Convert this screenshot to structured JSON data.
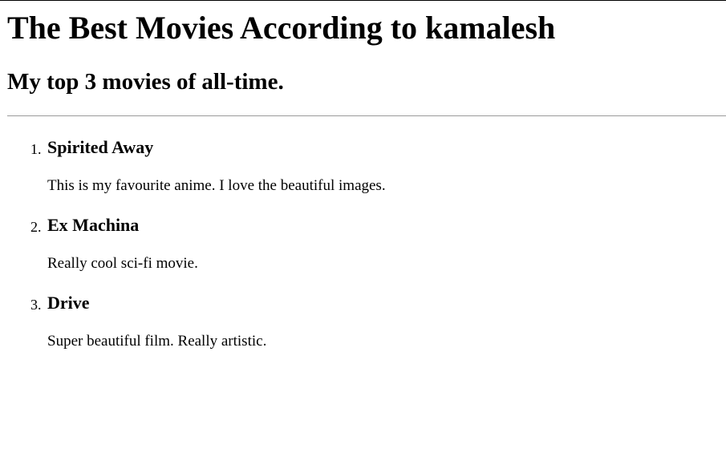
{
  "page": {
    "title": "The Best Movies According to kamalesh",
    "subtitle": "My top 3 movies of all-time."
  },
  "movies": [
    {
      "number": "1.",
      "title": "Spirited Away",
      "description": "This is my favourite anime. I love the beautiful images."
    },
    {
      "number": "2.",
      "title": "Ex Machina",
      "description": "Really cool sci-fi movie."
    },
    {
      "number": "3.",
      "title": "Drive",
      "description": "Super beautiful film. Really artistic."
    }
  ]
}
